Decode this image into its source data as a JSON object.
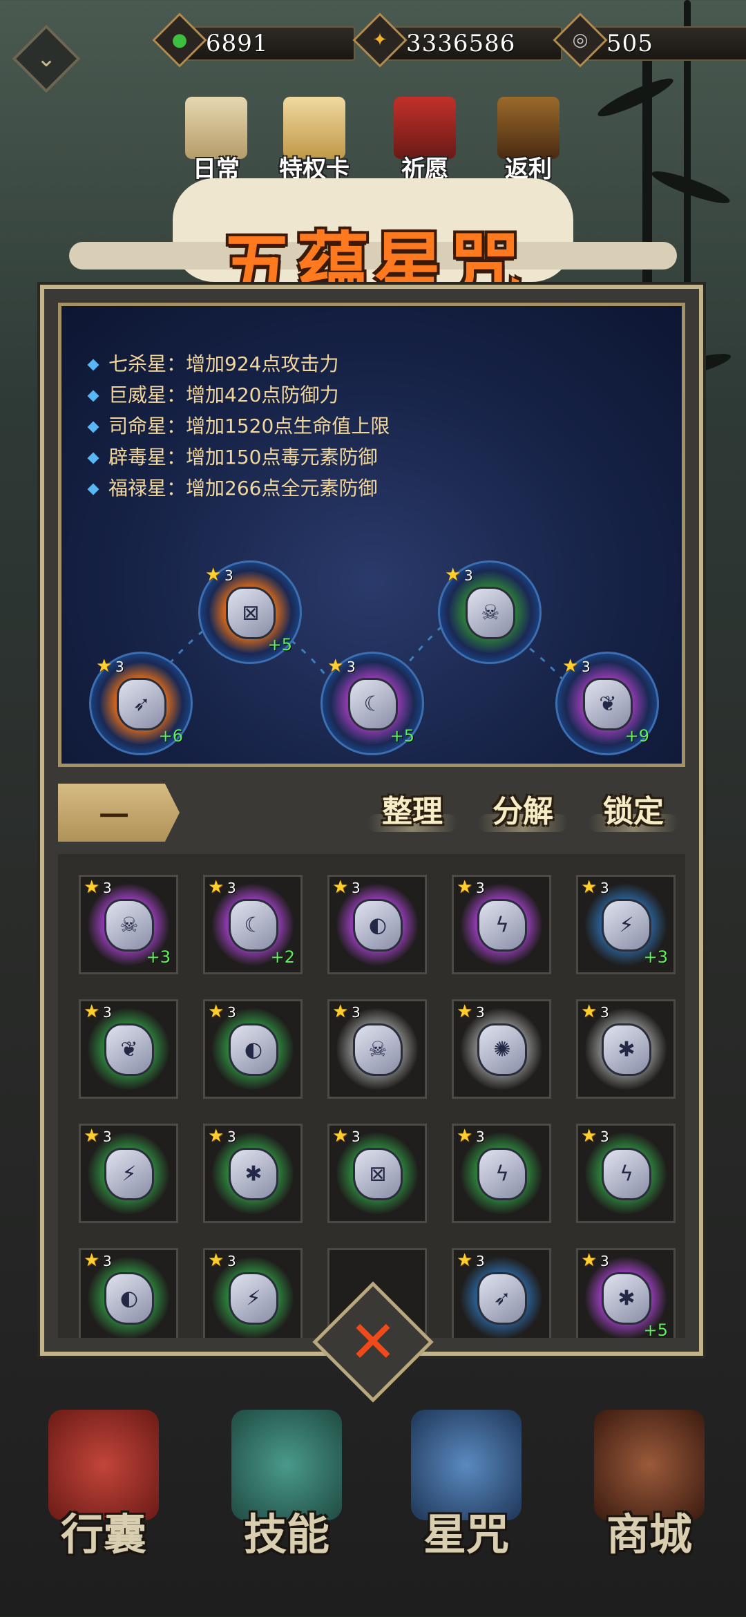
{
  "resources": [
    {
      "icon": "green-jade-icon",
      "value": "6891",
      "color": "#3fbf3f"
    },
    {
      "icon": "gold-coin-icon",
      "value": "3336586",
      "color": "#f0b030"
    },
    {
      "icon": "silver-swirl-icon",
      "value": "505",
      "color": "#c8c8c8"
    }
  ],
  "top_menu": [
    {
      "label": "日常",
      "icon": "scroll-icon"
    },
    {
      "label": "特权卡",
      "icon": "privilege-card-icon"
    },
    {
      "label": "祈愿",
      "icon": "shrine-gate-icon"
    },
    {
      "label": "返利",
      "icon": "treasure-chest-icon"
    }
  ],
  "title": "五蕴星咒",
  "bonuses": [
    "七杀星：增加924点攻击力",
    "巨威星：增加420点防御力",
    "司命星：增加1520点生命值上限",
    "辟毒星：增加150点毒元素防御",
    "福禄星：增加266点全元素防御"
  ],
  "equipped": [
    {
      "stars": "3",
      "plus": "+6",
      "aura": "#c8641e",
      "symbol": "➶"
    },
    {
      "stars": "3",
      "plus": "+5",
      "aura": "#c8641e",
      "symbol": "⊠"
    },
    {
      "stars": "3",
      "plus": "+5",
      "aura": "#8a3aa8",
      "symbol": "☾"
    },
    {
      "stars": "3",
      "plus": "",
      "aura": "#2c7a3a",
      "symbol": "☠"
    },
    {
      "stars": "3",
      "plus": "+9",
      "aura": "#8a3aa8",
      "symbol": "❦"
    }
  ],
  "tab_label": "一",
  "actions": [
    "整理",
    "分解",
    "锁定"
  ],
  "inventory": [
    {
      "stars": "3",
      "plus": "+3",
      "aura": "#8a3aa8",
      "symbol": "☠"
    },
    {
      "stars": "3",
      "plus": "+2",
      "aura": "#8a3aa8",
      "symbol": "☾"
    },
    {
      "stars": "3",
      "plus": "",
      "aura": "#8a3aa8",
      "symbol": "◐"
    },
    {
      "stars": "3",
      "plus": "",
      "aura": "#8a3aa8",
      "symbol": "ϟ"
    },
    {
      "stars": "3",
      "plus": "+3",
      "aura": "#2a5a8a",
      "symbol": "⚡"
    },
    {
      "stars": "3",
      "plus": "",
      "aura": "#2c7a3a",
      "symbol": "❦"
    },
    {
      "stars": "3",
      "plus": "",
      "aura": "#2c7a3a",
      "symbol": "◐"
    },
    {
      "stars": "3",
      "plus": "",
      "aura": "#7a7a7a",
      "symbol": "☠"
    },
    {
      "stars": "3",
      "plus": "",
      "aura": "#7a7a7a",
      "symbol": "✺"
    },
    {
      "stars": "3",
      "plus": "",
      "aura": "#7a7a7a",
      "symbol": "✱"
    },
    {
      "stars": "3",
      "plus": "",
      "aura": "#2c7a3a",
      "symbol": "⚡"
    },
    {
      "stars": "3",
      "plus": "",
      "aura": "#2c7a3a",
      "symbol": "✱"
    },
    {
      "stars": "3",
      "plus": "",
      "aura": "#2c7a3a",
      "symbol": "⊠"
    },
    {
      "stars": "3",
      "plus": "",
      "aura": "#2c7a3a",
      "symbol": "ϟ"
    },
    {
      "stars": "3",
      "plus": "",
      "aura": "#2c7a3a",
      "symbol": "ϟ"
    },
    {
      "stars": "3",
      "plus": "",
      "aura": "#2c7a3a",
      "symbol": "◐"
    },
    {
      "stars": "3",
      "plus": "",
      "aura": "#2c7a3a",
      "symbol": "⚡"
    },
    null,
    {
      "stars": "3",
      "plus": "",
      "aura": "#2a5a8a",
      "symbol": "➶"
    },
    {
      "stars": "3",
      "plus": "+5",
      "aura": "#8a3aa8",
      "symbol": "✱"
    }
  ],
  "bottom_nav": [
    {
      "label": "行囊",
      "icon": "bag-icon",
      "color": "#a8332a"
    },
    {
      "label": "技能",
      "icon": "dragon-sword-icon",
      "color": "#2f6a5e"
    },
    {
      "label": "星咒",
      "icon": "star-scroll-icon",
      "color": "#2e4f7a"
    },
    {
      "label": "商城",
      "icon": "shop-icon",
      "color": "#6a3a2a"
    }
  ]
}
